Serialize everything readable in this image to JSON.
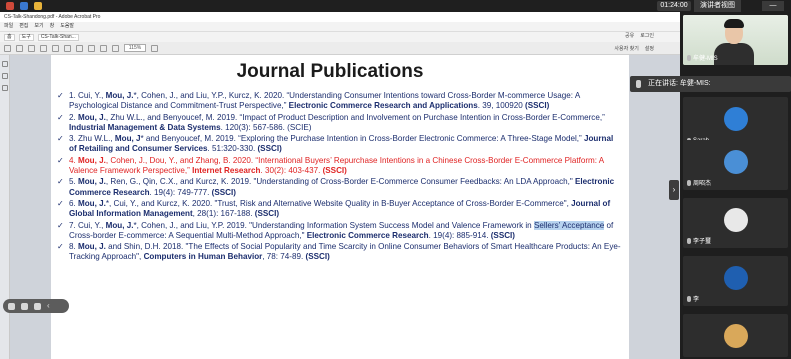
{
  "taskbar": {
    "clock": "01:24:00",
    "presenter_tab": "演讲者视图",
    "minimize": "—"
  },
  "acrobat": {
    "window_title": "CS-Talk-Shandong.pdf - Adobe Acrobat Pro",
    "menu": [
      "파일",
      "편집",
      "보기",
      "창",
      "도움말"
    ],
    "toolbar": [
      "홈",
      "도구",
      "CS-Talk-Shan..."
    ],
    "zoom": "115%",
    "right_links": [
      "사용자 찾기",
      "설정"
    ],
    "right_links2": [
      "공유",
      "로그인"
    ]
  },
  "page": {
    "title": "Journal Publications",
    "publications": [
      {
        "style": "normal",
        "text_before": "1. Cui, Y., ",
        "bold_author": "Mou, J.",
        "text_mid": "*, Cohen, J., and Liu, Y.P., Kurcz, K. 2020. “Understanding Consumer Intentions toward Cross-Border M-commerce Usage: A Psychological Distance and Commitment-Trust Perspective,” ",
        "journal": "Electronic Commerce Research and Applications",
        "text_after": ". 39, 100920 ",
        "index": "(SSCI)"
      },
      {
        "style": "normal",
        "text_before": "2. ",
        "bold_author": "Mou, J.",
        "text_mid": ", Zhu W.L., and Benyoucef, M. 2019. “Impact of Product Description and Involvement on Purchase Intention in Cross-Border E-Commerce,” ",
        "journal": "Industrial Management & Data Systems",
        "text_after": ". 120(3): 567-586. (SCIE)",
        "index": ""
      },
      {
        "style": "normal",
        "text_before": "3. Zhu W.L., ",
        "bold_author": "Mou, J",
        "text_mid": "* and Benyoucef, M. 2019. “Exploring the Purchase Intention in Cross-Border Electronic Commerce: A Three-Stage Model,” ",
        "journal": "Journal of Retailing and Consumer Services",
        "text_after": ". 51:320-330. ",
        "index": "(SSCI)"
      },
      {
        "style": "red",
        "text_before": "4. ",
        "bold_author": "Mou, J.",
        "text_mid": ", Cohen, J., Dou, Y., and Zhang, B. 2020. “International Buyers’ Repurchase Intentions in a Chinese Cross-Border E-Commerce Platform: A Valence Framework Perspective,” ",
        "journal": "Internet Research",
        "text_after": ". 30(2): 403-437. ",
        "index": "(SSCI)"
      },
      {
        "style": "normal",
        "text_before": "5. ",
        "bold_author": "Mou, J.",
        "text_mid": ", Ren, G., Qin, C.X., and Kurcz, K. 2019. \"Understanding of Cross-Border E-Commerce Consumer Feedbacks: An LDA Approach,\" ",
        "journal": "Electronic Commerce Research",
        "text_after": ". 19(4): 749-777. ",
        "index": "(SSCI)"
      },
      {
        "style": "normal",
        "text_before": "6. ",
        "bold_author": "Mou, J.",
        "text_mid": "*, Cui, Y., and Kurcz, K. 2020. \"Trust, Risk and Alternative Website Quality in B-Buyer Acceptance of Cross-Border E-Commerce\", ",
        "journal": "Journal of Global Information Management",
        "text_after": ", 28(1): 167-188. ",
        "index": "(SSCI)"
      },
      {
        "style": "normal",
        "text_before": "7. Cui, Y., ",
        "bold_author": "Mou, J.",
        "text_mid": "*, Cohen, J., and Liu, Y.P. 2019. \"Understanding Information System Success Model and Valence Framework in ",
        "highlight": "Sellers’ Acceptance",
        "text_mid2": " of Cross-border E-commerce: A Sequential Multi-Method Approach,\" ",
        "journal": "Electronic Commerce Research",
        "text_after": ". 19(4): 885-914. ",
        "index": "(SSCI)"
      },
      {
        "style": "normal",
        "text_before": "8. ",
        "bold_author": "Mou, J.",
        "text_mid": " and Shin, D.H. 2018. \"The Effects of Social Popularity and Time Scarcity in Online Consumer Behaviors of Smart Healthcare Products: An Eye-Tracking Approach\", ",
        "journal": "Computers in Human Behavior",
        "text_after": ", 78: 74-89. ",
        "index": "(SSCI)"
      }
    ]
  },
  "meeting": {
    "speaking_prefix": "正在讲话: ",
    "speaking_name": "牟健-MIS:",
    "participants": [
      {
        "name": "牟健-MIS",
        "kind": "video"
      },
      {
        "name": "Sarah",
        "kind": "avatar",
        "color": "#2f7fd6"
      },
      {
        "name": "周昭杰",
        "kind": "avatar",
        "color": "#4a8fd6"
      },
      {
        "name": "李子璽",
        "kind": "avatar",
        "color": "#e8e8e8"
      },
      {
        "name": "李",
        "kind": "avatar",
        "color": "#1f5fb0"
      },
      {
        "name": "",
        "kind": "avatar",
        "color": "#d9a85a"
      }
    ]
  }
}
